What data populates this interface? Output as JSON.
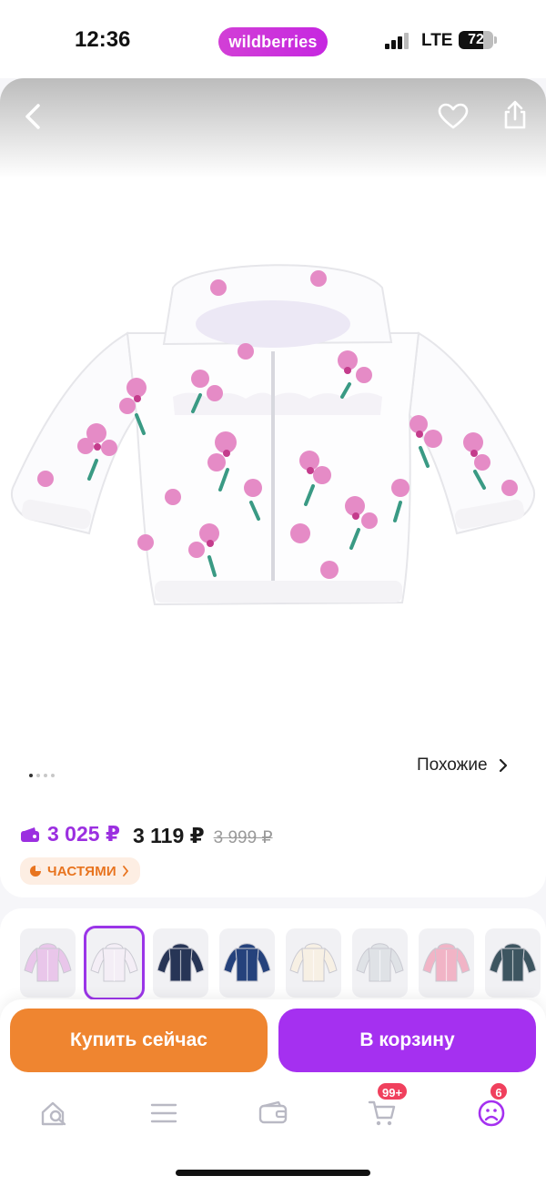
{
  "status_bar": {
    "time": "12:36",
    "brand": "wildberries",
    "network": "LTE",
    "battery": "72",
    "battery_level": 0.72
  },
  "product": {
    "similar_label": "Похожие",
    "gallery": {
      "count": 4,
      "active_index": 0
    }
  },
  "price": {
    "wallet_price": "3 025 ₽",
    "price": "3 119 ₽",
    "old_price": "3 999 ₽",
    "installment_label": "ЧАСТЯМИ"
  },
  "variants": [
    {
      "name": "lilac-floral",
      "color": "#e9c6ea",
      "selected": false
    },
    {
      "name": "white-pink-floral",
      "color": "#f4eef6",
      "selected": true
    },
    {
      "name": "navy-floral",
      "color": "#273556",
      "selected": false
    },
    {
      "name": "navy-orange",
      "color": "#25427c",
      "selected": false
    },
    {
      "name": "white-multicolor",
      "color": "#f7f0e4",
      "selected": false
    },
    {
      "name": "grey-dots",
      "color": "#dfe2e6",
      "selected": false
    },
    {
      "name": "pink",
      "color": "#f1b4c6",
      "selected": false
    },
    {
      "name": "dark-teal-orange",
      "color": "#3d5560",
      "selected": false
    }
  ],
  "actions": {
    "buy_now": "Купить сейчас",
    "add_to_cart": "В корзину"
  },
  "tabbar": {
    "cart_badge": "99+",
    "profile_badge": "6"
  },
  "colors": {
    "brand_purple": "#a530f0",
    "orange": "#ef8530",
    "wallet_price": "#9b2fe0",
    "badge": "#f0405d"
  }
}
